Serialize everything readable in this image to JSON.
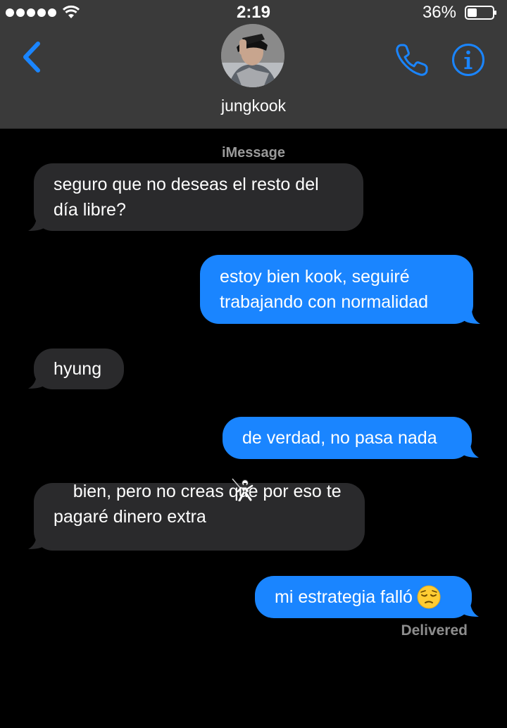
{
  "status_bar": {
    "time": "2:19",
    "battery": "36%"
  },
  "contact": {
    "name": "jungkook"
  },
  "conversation": {
    "service_label": "iMessage",
    "delivered_label": "Delivered",
    "messages": [
      {
        "direction": "incoming",
        "text": "seguro que no deseas el resto del\ndía libre?"
      },
      {
        "direction": "outgoing",
        "text": "estoy bien kook, seguiré\ntrabajando con normalidad"
      },
      {
        "direction": "incoming",
        "text": "hyung"
      },
      {
        "direction": "outgoing",
        "text": "de verdad, no pasa nada"
      },
      {
        "direction": "incoming",
        "text": "bien, pero no creas que por eso te\npagaré dinero extra",
        "emoji": "fencer-emoji"
      },
      {
        "direction": "outgoing",
        "text": "mi estrategia falló",
        "emoji": "pensive-face-emoji"
      }
    ]
  },
  "colors": {
    "header_bg": "#3a3a3a",
    "incoming_bubble": "#2a2a2c",
    "outgoing_bubble": "#1a85ff",
    "accent": "#1a85ff"
  }
}
